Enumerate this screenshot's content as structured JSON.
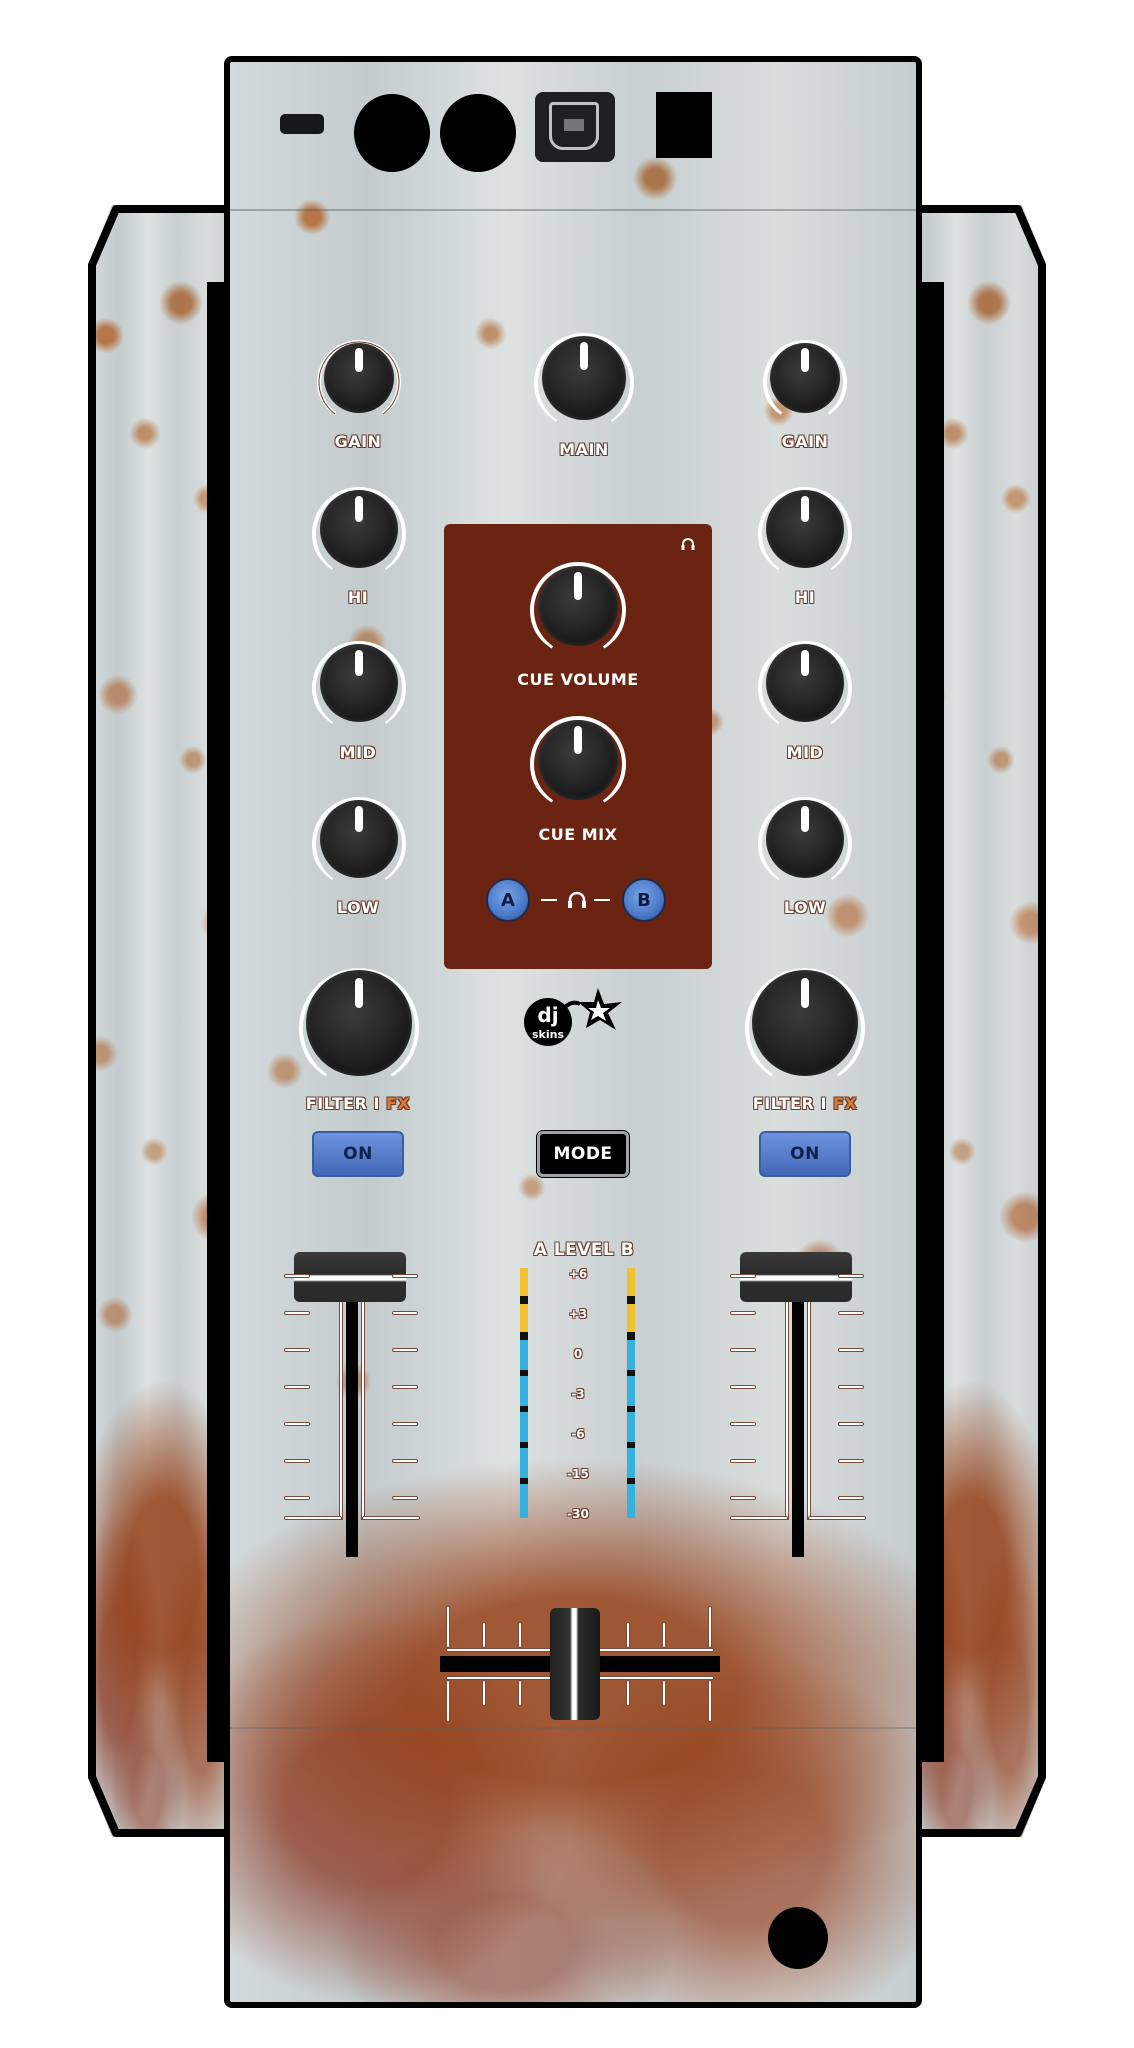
{
  "device": {
    "name": "DJ mixer controller skin",
    "theme": "rusted metal",
    "colors": {
      "cue_panel": "#6b2411",
      "button_blue": "#4a78c8",
      "meter_yellow": "#f2c12e",
      "meter_blue": "#35b1e0",
      "label_outline": "#6a3d2e",
      "fx_accent": "#d9793a"
    }
  },
  "ports": [
    {
      "name": "power-switch-slot"
    },
    {
      "name": "audio-jack-1"
    },
    {
      "name": "audio-jack-2"
    },
    {
      "name": "usb-port"
    },
    {
      "name": "power-input"
    }
  ],
  "deck_a": {
    "gain_label": "GAIN",
    "hi_label": "HI",
    "mid_label": "MID",
    "low_label": "LOW",
    "filter_label": "FILTER",
    "filter_sep": "I",
    "fx_label": "FX",
    "on_button": "ON",
    "cue_button": "A"
  },
  "deck_b": {
    "gain_label": "GAIN",
    "hi_label": "HI",
    "mid_label": "MID",
    "low_label": "LOW",
    "filter_label": "FILTER",
    "filter_sep": "I",
    "fx_label": "FX",
    "on_button": "ON",
    "cue_button": "B"
  },
  "master": {
    "main_label": "MAIN",
    "mode_button": "MODE"
  },
  "cue_section": {
    "cue_volume_label": "CUE VOLUME",
    "cue_mix_label": "CUE MIX"
  },
  "level_meter": {
    "title": "A LEVEL B",
    "scale": [
      "+6",
      "+3",
      "0",
      "-3",
      "-6",
      "-15",
      "-30"
    ]
  },
  "logo": {
    "line1": "dj",
    "line2": "skins"
  }
}
